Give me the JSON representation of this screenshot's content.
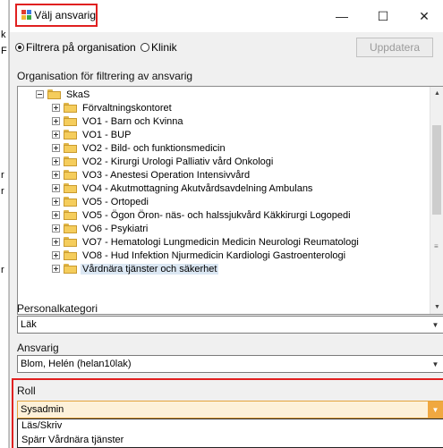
{
  "window": {
    "title": "Välj ansvarig",
    "controls": {
      "minimize": "—",
      "maximize": "☐",
      "close": "✕"
    }
  },
  "background": {
    "chars": [
      "k",
      "F",
      "r",
      "r",
      "r"
    ]
  },
  "filter": {
    "option_org": "Filtrera på organisation",
    "option_clinic": "Klinik",
    "selected": "organisation",
    "update_button": "Uppdatera"
  },
  "org_tree": {
    "label": "Organisation för filtrering av ansvarig",
    "root": "SkaS",
    "children": [
      "Förvaltningskontoret",
      "VO1 - Barn och Kvinna",
      "VO1 - BUP",
      "VO2 - Bild- och funktionsmedicin",
      "VO2 - Kirurgi Urologi Palliativ vård Onkologi",
      "VO3 - Anestesi Operation Intensivvård",
      "VO4 - Akutmottagning Akutvårdsavdelning Ambulans",
      "VO5 - Ortopedi",
      "VO5 - Ögon Öron- näs- och halssjukvård Käkkirurgi Logopedi",
      "VO6 - Psykiatri",
      "VO7 - Hematologi Lungmedicin Medicin Neurologi Reumatologi",
      "VO8 - Hud Infektion Njurmedicin Kardiologi Gastroenterologi",
      "Vårdnära tjänster och säkerhet"
    ],
    "selected_index": 12
  },
  "personal": {
    "label": "Personalkategori",
    "value": "Läk"
  },
  "ansvarig": {
    "label": "Ansvarig",
    "value": "Blom, Helén (helan10lak)"
  },
  "roll": {
    "label": "Roll",
    "value": "Sysadmin",
    "options": [
      "Läs/Skriv",
      "Spärr Vårdnära tjänster"
    ]
  },
  "colors": {
    "highlight_red": "#e02020",
    "selection_bg": "#dbe7f3",
    "roll_focus": "#f0a840"
  },
  "icons": {
    "app": "app-window-icon",
    "expand": "expand-box-icon",
    "folder": "folder-icon",
    "dropdown": "chevron-down-icon"
  }
}
